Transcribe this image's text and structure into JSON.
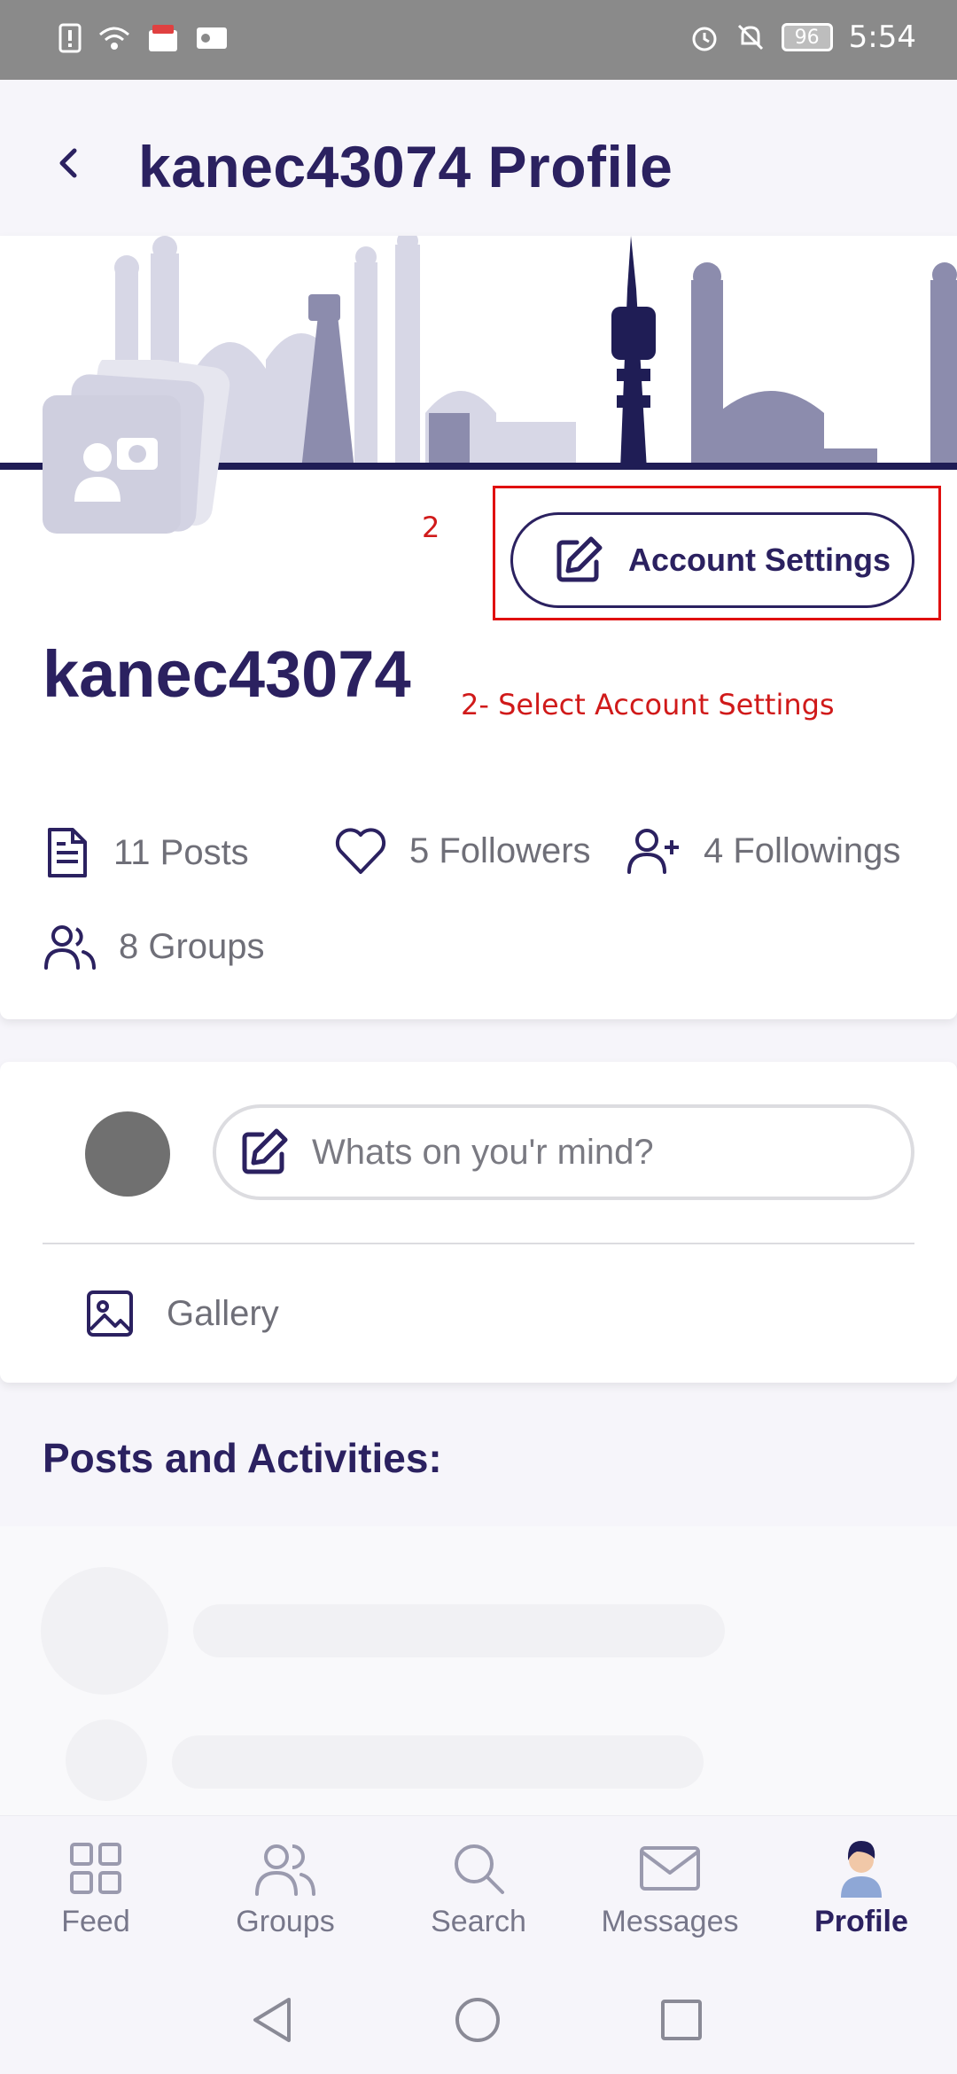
{
  "status_bar": {
    "time": "5:54",
    "battery": "96"
  },
  "header": {
    "title": "kanec43074 Profile"
  },
  "profile": {
    "username": "kanec43074",
    "account_settings_label": "Account Settings",
    "stats": {
      "posts": "11 Posts",
      "followers": "5 Followers",
      "followings": "4 Followings",
      "groups": "8 Groups"
    }
  },
  "annotation": {
    "number": "2",
    "text": "2- Select Account Settings",
    "color": "#e01010"
  },
  "composer": {
    "placeholder": "Whats on you'r mind?",
    "gallery_label": "Gallery"
  },
  "posts_section": {
    "title": "Posts and Activities:"
  },
  "bottom_nav": {
    "items": [
      {
        "label": "Feed",
        "icon": "grid-icon"
      },
      {
        "label": "Groups",
        "icon": "users-icon"
      },
      {
        "label": "Search",
        "icon": "search-icon"
      },
      {
        "label": "Messages",
        "icon": "mail-icon"
      },
      {
        "label": "Profile",
        "icon": "avatar-icon",
        "active": true
      }
    ]
  },
  "colors": {
    "primary": "#2b2160",
    "muted": "#6f6f78",
    "background": "#f6f5fa"
  }
}
